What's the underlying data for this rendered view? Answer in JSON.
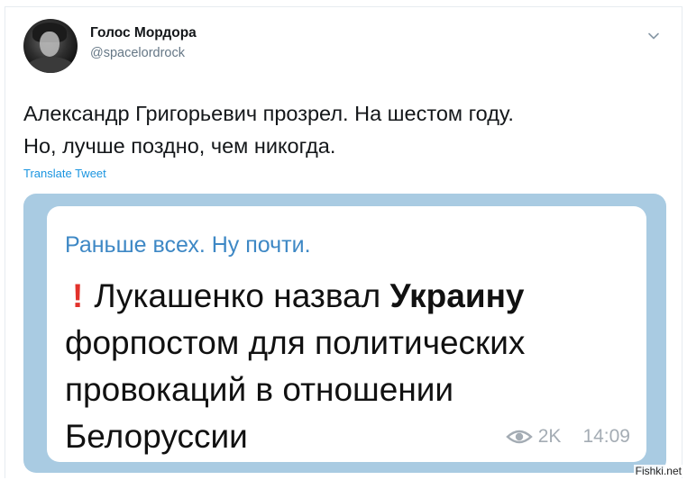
{
  "author": {
    "name": "Голос Мордора",
    "handle": "@spacelordrock"
  },
  "tweet": {
    "lines": [
      "Александр Григорьевич прозрел. На шестом году.",
      "Но, лучше поздно, чем никогда."
    ],
    "translate_label": "Translate Tweet"
  },
  "media": {
    "channel": "Раньше всех. Ну почти.",
    "message": {
      "line1_prefix": "Лукашенко назвал ",
      "line1_bold": "Украину",
      "line2": "форпостом для политических",
      "line3": "провокаций в отношении",
      "line4": "Белоруссии"
    },
    "views": "2K",
    "time": "14:09"
  },
  "watermark": "Fishki.net",
  "icons": {
    "chevron": "chevron-down-icon",
    "exclamation": "exclamation-icon",
    "eye": "eye-icon"
  },
  "colors": {
    "link": "#1b95e0",
    "channel": "#3e88c5",
    "exclamation": "#e2322b",
    "media_bg": "#a9cbe2"
  }
}
